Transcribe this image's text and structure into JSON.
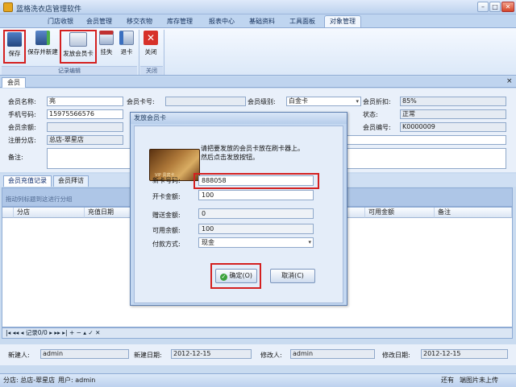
{
  "app": {
    "title": "蓝格洗衣店管理软件"
  },
  "ribbon_tabs": [
    "门店收银",
    "会员管理",
    "移交衣物",
    "库存管理",
    "报表中心",
    "基础资料",
    "工具面板",
    "对象管理"
  ],
  "ribbon": {
    "save": "保存",
    "save_new": "保存并新建",
    "issue_card": "发放会员卡",
    "report_loss": "挂失",
    "return_card": "退卡",
    "close": "关闭",
    "group_edit": "记录编辑",
    "group_close": "关闭"
  },
  "doc_tab": "会员",
  "form": {
    "name_label": "会员名称:",
    "name_value": "亮",
    "cardno_label": "会员卡号:",
    "cardno_value": "",
    "level_label": "会员级别:",
    "level_value": "白金卡",
    "discount_label": "会员折扣:",
    "discount_value": "85%",
    "phone_label": "手机号码:",
    "phone_value": "15975566576",
    "state_label": "状态:",
    "state_value": "正常",
    "balance_label": "会员余额:",
    "code_label": "会员编号:",
    "code_value": "K0000009",
    "store_label": "注册分店:",
    "store_value": "总店-翠星店",
    "remark_label": "备注:"
  },
  "sub_tabs": [
    "会员充值记录",
    "会员拜访"
  ],
  "grid": {
    "group_hint": "拖动列标题到这进行分组",
    "columns": [
      "分店",
      "充值日期",
      "可用金额",
      "备注"
    ],
    "nav_text": "记录0/0"
  },
  "bottom": {
    "creator_label": "新建人:",
    "creator_value": "admin",
    "created_label": "新建日期:",
    "created_value": "2012-12-15",
    "modifier_label": "修改人:",
    "modifier_value": "admin",
    "modified_label": "修改日期:",
    "modified_value": "2012-12-15"
  },
  "status": {
    "branch": "分店: 总店-翠星店",
    "user": "用户: admin",
    "right1": "还有",
    "right2": "端图片未上传"
  },
  "dialog": {
    "title": "发放会员卡",
    "message1": "请把要发放的会员卡放在刷卡器上。",
    "message2": "然后点击发放按钮。",
    "card_text": "VIP 贵宾卡",
    "new_card_label": "新卡号码:",
    "new_card_value": "888058",
    "opening_label": "开卡金额:",
    "opening_value": "100",
    "gift_label": "赠送金额:",
    "gift_value": "0",
    "available_label": "可用余额:",
    "available_value": "100",
    "payment_label": "付款方式:",
    "payment_value": "现金",
    "ok": "确定(O)",
    "cancel": "取消(C)"
  },
  "colors": {
    "highlight": "#d42020",
    "accent": "#1e395b"
  }
}
